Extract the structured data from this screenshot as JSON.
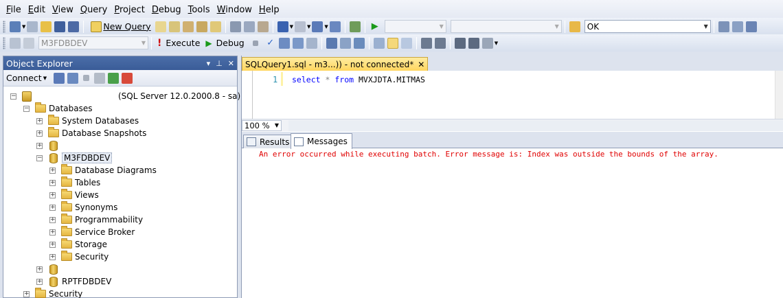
{
  "menu": {
    "items": [
      {
        "label": "File",
        "accel": "F"
      },
      {
        "label": "Edit",
        "accel": "E"
      },
      {
        "label": "View",
        "accel": "V"
      },
      {
        "label": "Query",
        "accel": "Q"
      },
      {
        "label": "Project",
        "accel": "P"
      },
      {
        "label": "Debug",
        "accel": "D"
      },
      {
        "label": "Tools",
        "accel": "T"
      },
      {
        "label": "Window",
        "accel": "W"
      },
      {
        "label": "Help",
        "accel": "H"
      }
    ]
  },
  "toolbar1": {
    "new_query_label": "New Query",
    "solution_combo_value": "OK"
  },
  "toolbar2": {
    "database_combo_value": "M3FDBDEV",
    "execute_label": "Execute",
    "debug_label": "Debug"
  },
  "object_explorer": {
    "title": "Object Explorer",
    "connect_label": "Connect",
    "server_suffix": "(SQL Server 12.0.2000.8 - sa)",
    "tree": {
      "databases": "Databases",
      "system_databases": "System Databases",
      "database_snapshots": "Database Snapshots",
      "selected_db": "M3FDBDEV",
      "children": [
        "Database Diagrams",
        "Tables",
        "Views",
        "Synonyms",
        "Programmability",
        "Service Broker",
        "Storage",
        "Security"
      ],
      "rpt_db": "RPTFDBDEV",
      "security": "Security"
    }
  },
  "editor": {
    "tab_label": "SQLQuery1.sql - m3...)) - not connected*",
    "line_number": "1",
    "code": {
      "kw_select": "select",
      "star": "*",
      "kw_from": "from",
      "table": "MVXJDTA.MITMAS"
    },
    "zoom": "100 %"
  },
  "results": {
    "tabs": [
      {
        "label": "Results"
      },
      {
        "label": "Messages"
      }
    ],
    "error_message": "An error occurred while executing batch. Error message is: Index was outside the bounds of the array."
  },
  "colors": {
    "error": "#e00000",
    "keyword": "#0000ff",
    "title_bar": "#3a5c98",
    "active_tab": "#ffd55e"
  }
}
